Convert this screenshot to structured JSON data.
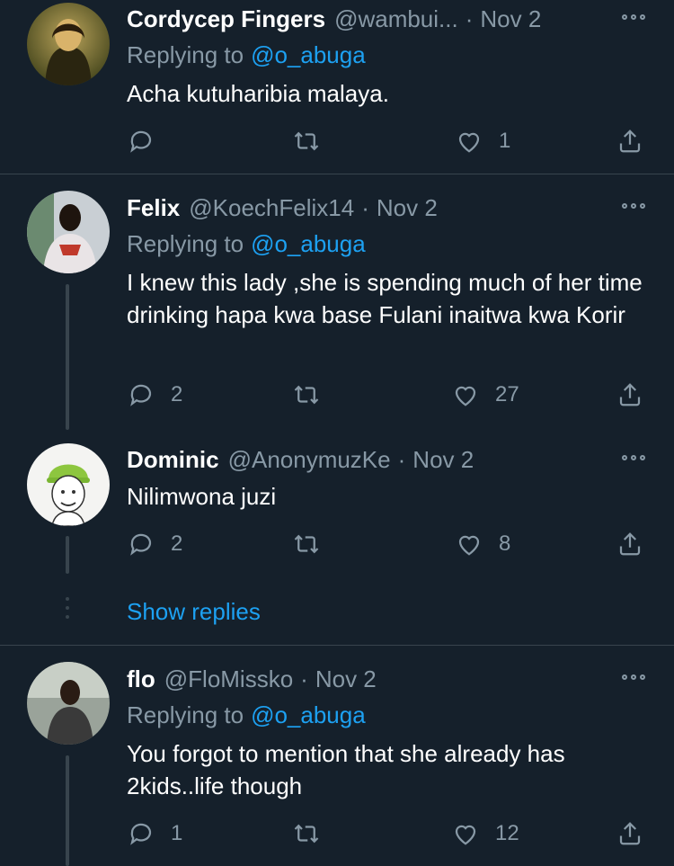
{
  "tweets": [
    {
      "name": "Cordycep Fingers",
      "handle": "@wambui...",
      "sep": "·",
      "date": "Nov 2",
      "replying_label": "Replying to",
      "replying_handle": "@o_abuga",
      "text": "Acha kutuharibia malaya.",
      "replies": "",
      "likes": "1"
    },
    {
      "name": "Felix",
      "handle": "@KoechFelix14",
      "sep": "·",
      "date": "Nov 2",
      "replying_label": "Replying to",
      "replying_handle": "@o_abuga",
      "text": "I knew this lady ,she is spending much of her time drinking hapa kwa base Fulani inaitwa kwa Korir",
      "replies": "2",
      "likes": "27"
    },
    {
      "name": "Dominic",
      "handle": "@AnonymuzKe",
      "sep": "·",
      "date": "Nov 2",
      "text": "Nilimwona juzi",
      "replies": "2",
      "likes": "8"
    },
    {
      "name": "flo",
      "handle": "@FloMissko",
      "sep": "·",
      "date": "Nov 2",
      "replying_label": "Replying to",
      "replying_handle": "@o_abuga",
      "text": "You forgot to mention that she already has 2kids..life though",
      "replies": "1",
      "likes": "12"
    }
  ],
  "show_replies": "Show replies",
  "colors": {
    "background": "#15202b",
    "text": "#ffffff",
    "secondary": "#8899a6",
    "accent": "#1da1f2",
    "divider": "#38444d"
  },
  "icons": [
    "reply-icon",
    "retweet-icon",
    "like-icon",
    "share-icon",
    "more-icon"
  ]
}
